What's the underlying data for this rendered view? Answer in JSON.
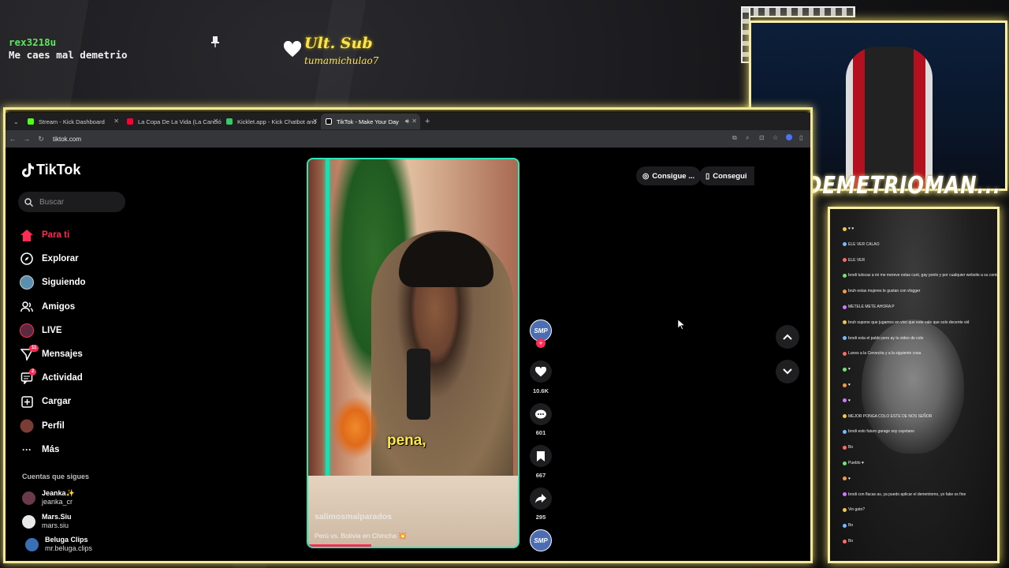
{
  "overlay": {
    "chat_user": "rex3218u",
    "chat_message": "Me caes mal demetrio",
    "sub_title": "Ult. Sub",
    "sub_user": "tumamichulao7",
    "brand": "DEMETRIOMAN..."
  },
  "browser": {
    "tabs": [
      {
        "label": "Stream - Kick Dashboard",
        "color": "#53fc18"
      },
      {
        "label": "La Copa De La Vida (La Canción",
        "color": "#ff0033"
      },
      {
        "label": "Kicklet.app - Kick Chatbot and",
        "color": "#33cc66"
      },
      {
        "label": "TikTok - Make Your Day",
        "color": "#ffffff"
      }
    ],
    "url": "tiktok.com"
  },
  "tiktok": {
    "logo": "TikTok",
    "search_placeholder": "Buscar",
    "menu": [
      {
        "label": "Para ti",
        "icon": "home-icon"
      },
      {
        "label": "Explorar",
        "icon": "compass-icon"
      },
      {
        "label": "Siguiendo",
        "icon": "following-icon"
      },
      {
        "label": "Amigos",
        "icon": "friends-icon"
      },
      {
        "label": "LIVE",
        "icon": "live-icon"
      },
      {
        "label": "Mensajes",
        "icon": "messages-icon",
        "badge": "11"
      },
      {
        "label": "Actividad",
        "icon": "activity-icon",
        "badge": "2"
      },
      {
        "label": "Cargar",
        "icon": "upload-icon"
      },
      {
        "label": "Perfil",
        "icon": "profile-icon"
      },
      {
        "label": "Más",
        "icon": "more-icon"
      }
    ],
    "following_heading": "Cuentas que sigues",
    "following": [
      {
        "name": "Jeanka✨",
        "handle": "jeanka_cr"
      },
      {
        "name": "Mars.Siu",
        "handle": "mars.siu"
      },
      {
        "name": "Beluga Clips",
        "handle": "mr.beluga.clips"
      }
    ],
    "video": {
      "caption": "pena,",
      "username": "salimosmalparados",
      "description": "Perú vs. Bolivia en Chincha 💥",
      "progress": 0.3
    },
    "actions": {
      "avatar_text": "SMP",
      "likes": "10.6K",
      "comments": "601",
      "saves": "667",
      "shares": "295"
    },
    "top_buttons": [
      "Consigue ...",
      "Consegui"
    ]
  },
  "chat_panel": {
    "messages": [
      {
        "user": "",
        "text": "♥ ♥"
      },
      {
        "user": "",
        "text": "ELE VER CALAO"
      },
      {
        "user": "",
        "text": "ELE VER"
      },
      {
        "user": "",
        "text": "brodi tulocas a mi me mereve estas cunt, gay ponlo y por cualquier website a su contacto y vea bien"
      },
      {
        "user": "",
        "text": "bruh estas mujeres le gustan con vlogger"
      },
      {
        "user": "",
        "text": "METELE METE AHORA P"
      },
      {
        "user": "",
        "text": "bruh supone que jugamos en vivo que este vale que solo decente vid"
      },
      {
        "user": "",
        "text": "brodi esta el pablo pero ay tu video de colo"
      },
      {
        "user": "",
        "text": "Lunes a la Cervecita y a la siguiente cosa"
      },
      {
        "user": "",
        "text": "♥"
      },
      {
        "user": "",
        "text": "♥"
      },
      {
        "user": "",
        "text": "♥"
      },
      {
        "user": "",
        "text": "MEJOR PONGA COLO ESTE DE NOS SEÑOR"
      },
      {
        "user": "",
        "text": "brodi esto futuro garage soy cayetano"
      },
      {
        "user": "",
        "text": "Bo"
      },
      {
        "user": "",
        "text": "Pueblo ♥"
      },
      {
        "user": "",
        "text": "♥"
      },
      {
        "user": "",
        "text": "brodi con flacas as, ya puedo aplicar el demetriomo, yo fake os fine"
      },
      {
        "user": "",
        "text": "Vin gato?"
      },
      {
        "user": "",
        "text": "Bo"
      },
      {
        "user": "",
        "text": "Bo"
      }
    ]
  }
}
